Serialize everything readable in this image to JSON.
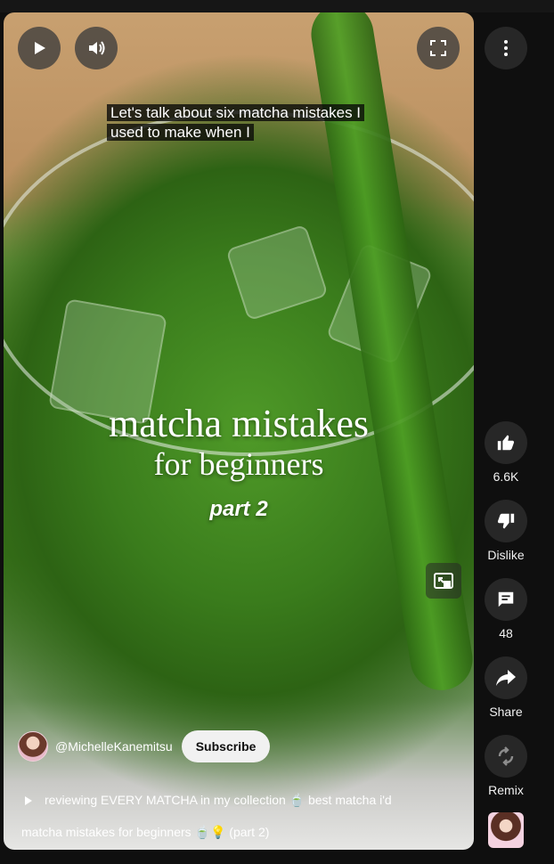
{
  "video": {
    "caption_line1": "Let's talk about six matcha mistakes I",
    "caption_line2": "used to make when I",
    "overlay_title": "matcha mistakes",
    "overlay_subtitle": "for beginners",
    "overlay_part": "part 2",
    "progress": 0.03
  },
  "channel": {
    "handle": "@MichelleKanemitsu",
    "subscribe_label": "Subscribe"
  },
  "suggestion": "reviewing EVERY MATCHA in my collection 🍵 best matcha i'd",
  "description": "matcha mistakes for beginners 🍵💡 (part 2)",
  "actions": {
    "like_count": "6.6K",
    "dislike_label": "Dislike",
    "comment_count": "48",
    "share_label": "Share",
    "remix_label": "Remix"
  },
  "colors": {
    "accent": "#ff0033",
    "button_bg": "#272727"
  },
  "icons": [
    "play-icon",
    "volume-icon",
    "fullscreen-icon",
    "more-icon",
    "thumbs-up-icon",
    "thumbs-down-icon",
    "comment-icon",
    "share-icon",
    "remix-icon",
    "pip-icon"
  ]
}
